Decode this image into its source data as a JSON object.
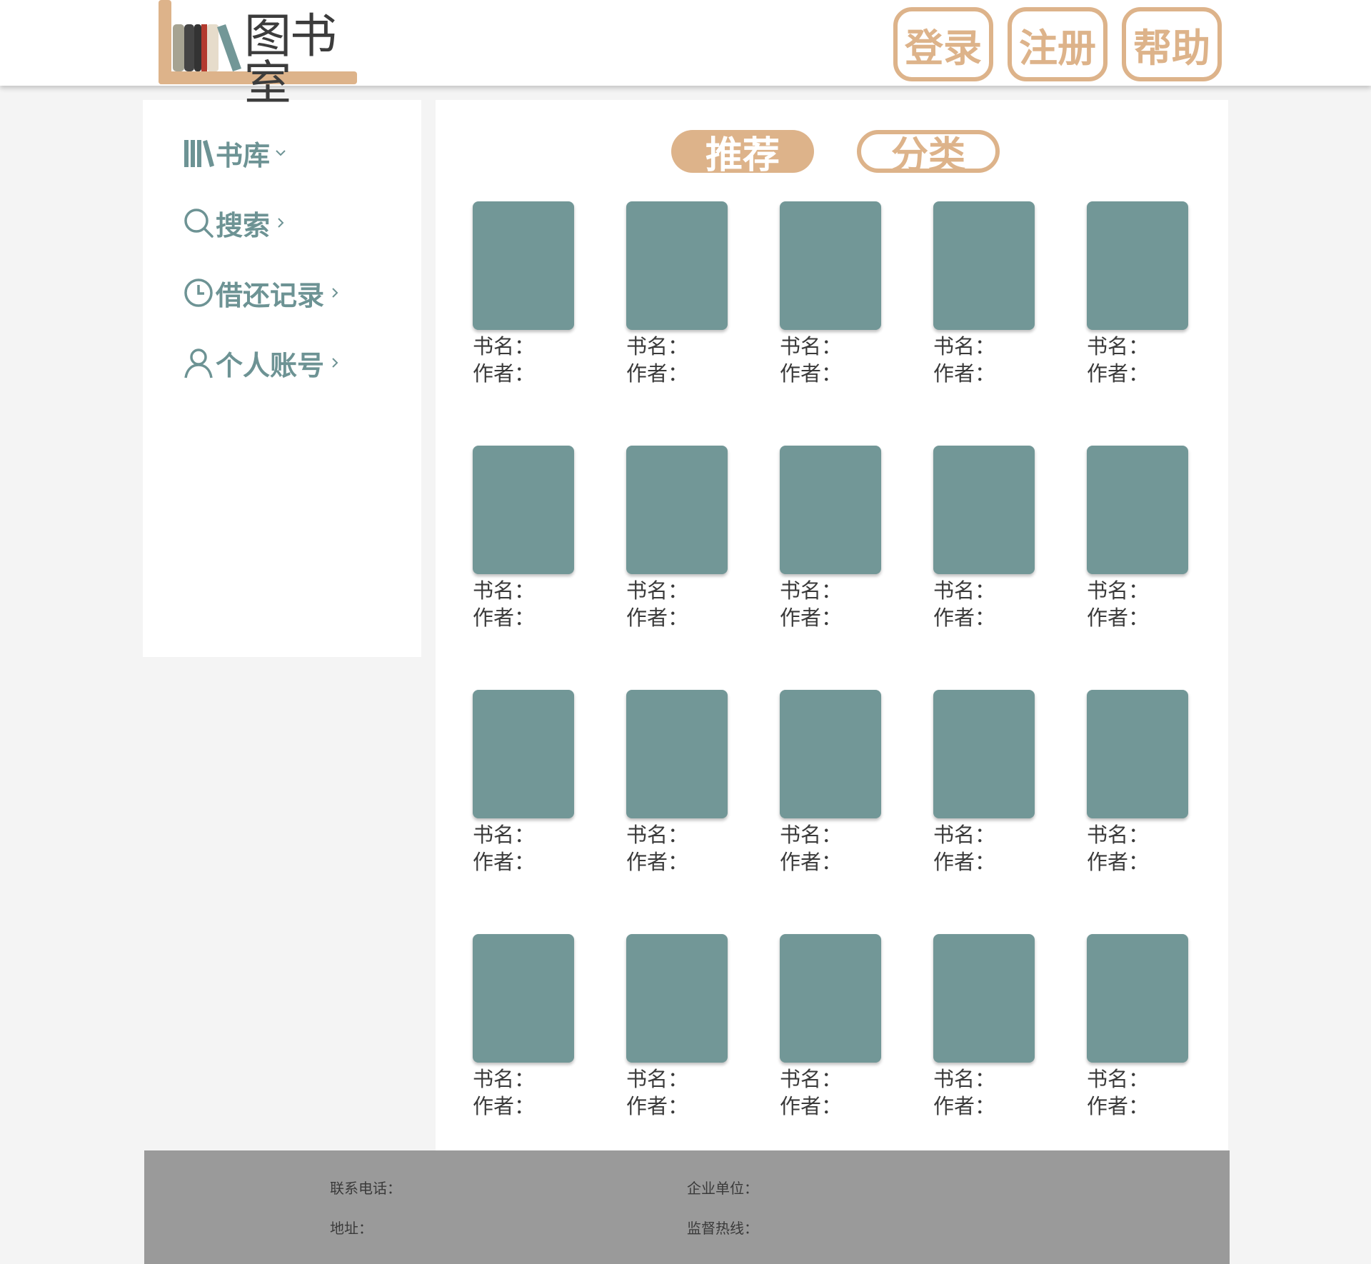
{
  "header": {
    "logo_text": "图书室",
    "buttons": [
      "登录",
      "注册",
      "帮助"
    ]
  },
  "sidebar": {
    "items": [
      {
        "label": "书库",
        "icon": "books-icon",
        "chevron": "chevron-down-icon"
      },
      {
        "label": "搜索",
        "icon": "search-icon",
        "chevron": "chevron-right-icon"
      },
      {
        "label": "借还记录",
        "icon": "clock-icon",
        "chevron": "chevron-right-icon"
      },
      {
        "label": "个人账号",
        "icon": "user-icon",
        "chevron": "chevron-right-icon"
      }
    ]
  },
  "main": {
    "tabs": [
      {
        "label": "推荐",
        "active": true
      },
      {
        "label": "分类",
        "active": false
      }
    ],
    "books": [
      {
        "title_label": "书名：",
        "author_label": "作者："
      },
      {
        "title_label": "书名：",
        "author_label": "作者："
      },
      {
        "title_label": "书名：",
        "author_label": "作者："
      },
      {
        "title_label": "书名：",
        "author_label": "作者："
      },
      {
        "title_label": "书名：",
        "author_label": "作者："
      },
      {
        "title_label": "书名：",
        "author_label": "作者："
      },
      {
        "title_label": "书名：",
        "author_label": "作者："
      },
      {
        "title_label": "书名：",
        "author_label": "作者："
      },
      {
        "title_label": "书名：",
        "author_label": "作者："
      },
      {
        "title_label": "书名：",
        "author_label": "作者："
      },
      {
        "title_label": "书名：",
        "author_label": "作者："
      },
      {
        "title_label": "书名：",
        "author_label": "作者："
      },
      {
        "title_label": "书名：",
        "author_label": "作者："
      },
      {
        "title_label": "书名：",
        "author_label": "作者："
      },
      {
        "title_label": "书名：",
        "author_label": "作者："
      },
      {
        "title_label": "书名：",
        "author_label": "作者："
      },
      {
        "title_label": "书名：",
        "author_label": "作者："
      },
      {
        "title_label": "书名：",
        "author_label": "作者："
      },
      {
        "title_label": "书名：",
        "author_label": "作者："
      },
      {
        "title_label": "书名：",
        "author_label": "作者："
      }
    ]
  },
  "footer": {
    "phone_label": "联系电话：",
    "company_label": "企业单位：",
    "address_label": "地址：",
    "hotline_label": "监督热线："
  },
  "colors": {
    "accent": "#ddb38a",
    "teal": "#729797",
    "nav_text": "#6d9394",
    "footer_bg": "#9a9a9a",
    "page_bg": "#f4f4f4"
  }
}
